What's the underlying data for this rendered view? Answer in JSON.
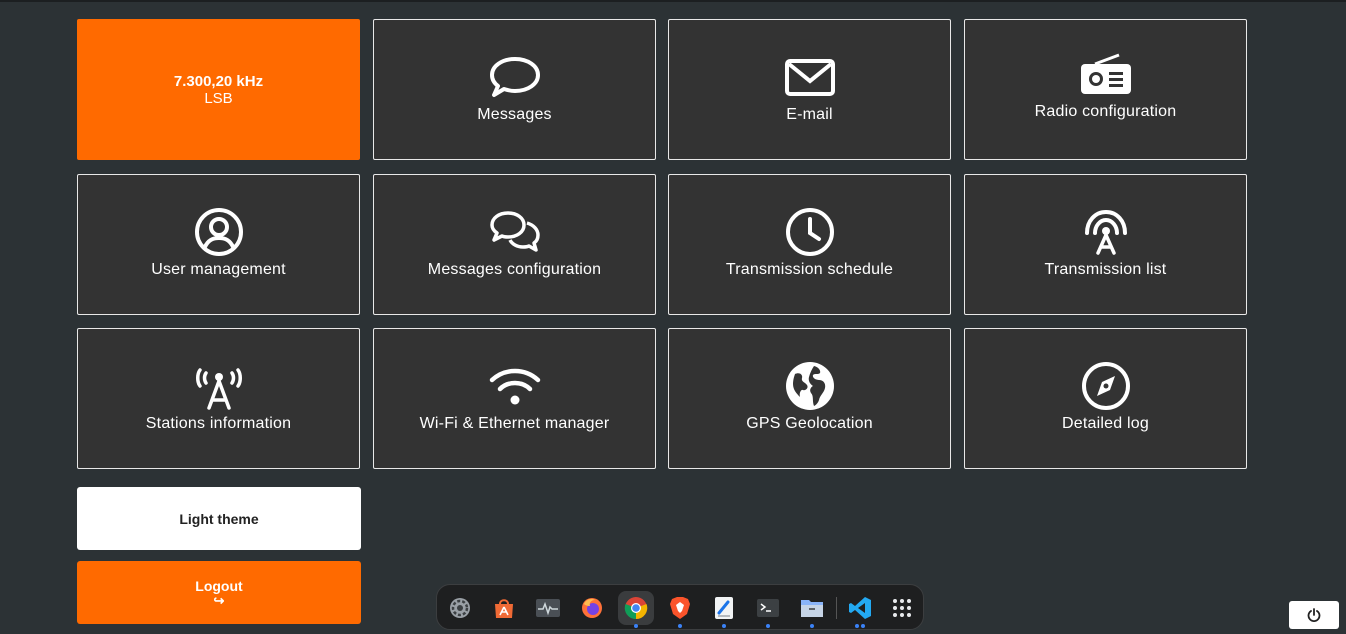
{
  "frequency": {
    "value": "7.300,20 kHz",
    "mode": "LSB"
  },
  "tiles": {
    "messages": "Messages",
    "email": "E-mail",
    "radio_configuration": "Radio configuration",
    "user_management": "User management",
    "messages_configuration": "Messages configuration",
    "transmission_schedule": "Transmission schedule",
    "transmission_list": "Transmission list",
    "stations_information": "Stations information",
    "wifi_ethernet_manager": "Wi-Fi & Ethernet manager",
    "gps_geolocation": "GPS Geolocation",
    "detailed_log": "Detailed log"
  },
  "buttons": {
    "light_theme": "Light theme",
    "logout": "Logout",
    "logout_icon": "↪"
  },
  "colors": {
    "accent": "#ff6a00",
    "background": "#2c3235",
    "tile": "#333333"
  },
  "dock": {
    "items": [
      "settings-icon",
      "app-store-icon",
      "system-monitor-icon",
      "firefox-icon",
      "chrome-icon",
      "brave-icon",
      "text-editor-icon",
      "terminal-icon",
      "files-icon",
      "vscode-icon",
      "app-grid-icon"
    ]
  }
}
